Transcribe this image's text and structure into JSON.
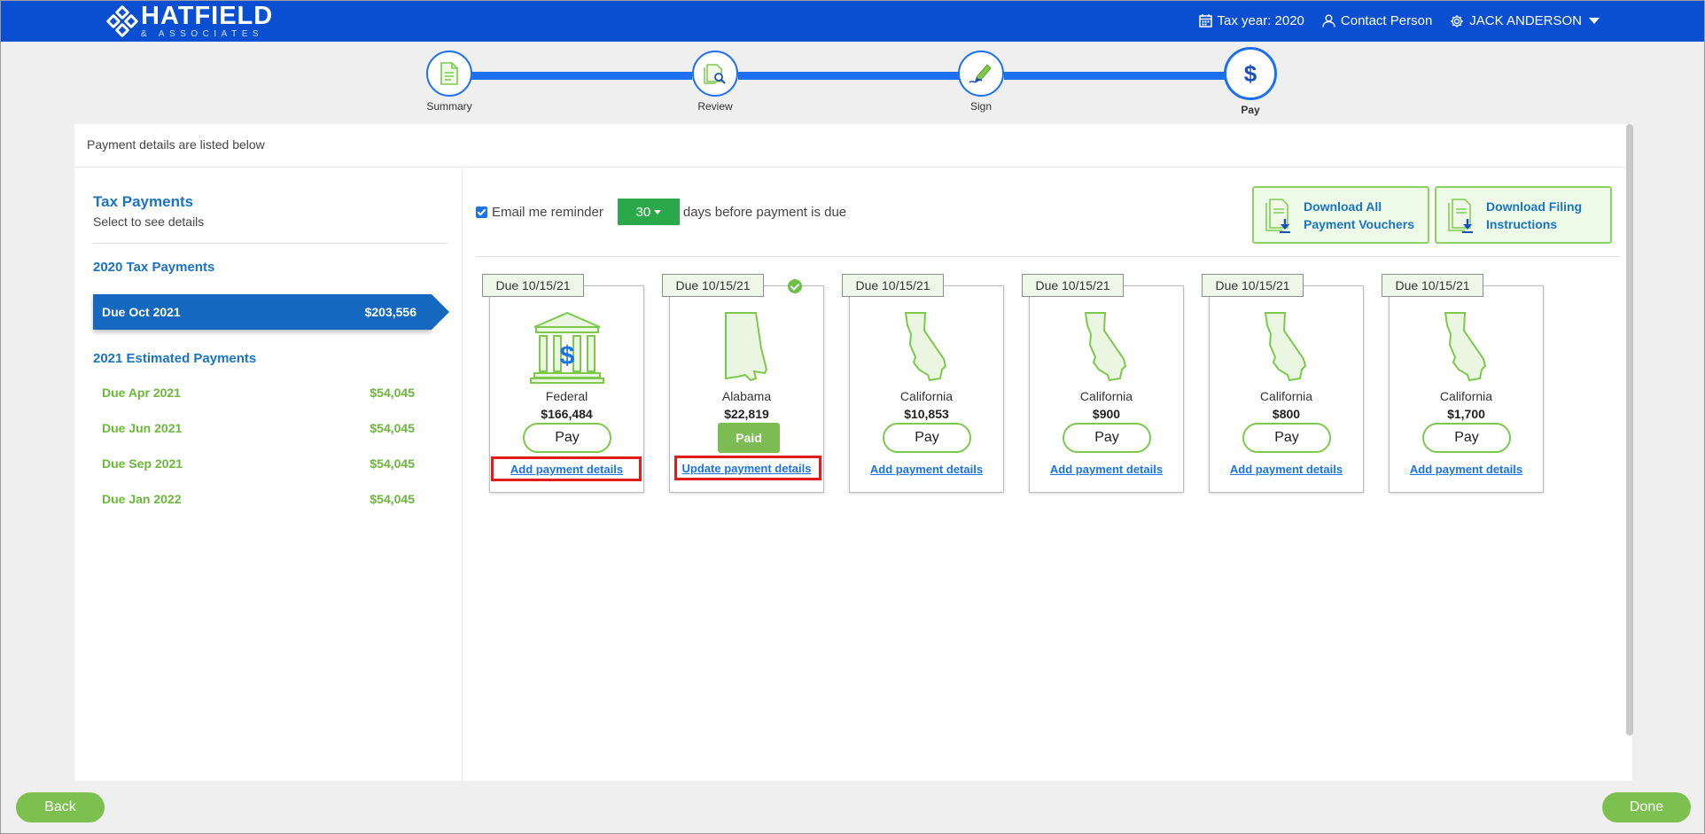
{
  "header": {
    "brand_name": "HATFIELD",
    "brand_sub": "& ASSOCIATES",
    "tax_year": "Tax year: 2020",
    "contact": "Contact Person",
    "user": "JACK ANDERSON",
    "bg_color": "#0a4fd1"
  },
  "stepper": {
    "steps": [
      {
        "label": "Summary",
        "icon": "document-icon"
      },
      {
        "label": "Review",
        "icon": "document-search-icon"
      },
      {
        "label": "Sign",
        "icon": "pen-sign-icon"
      },
      {
        "label": "Pay",
        "icon": "dollar-icon"
      }
    ],
    "active": "Pay"
  },
  "panel": {
    "heading": "Payment details are listed below"
  },
  "sidebar": {
    "title": "Tax Payments",
    "subtitle": "Select to see details",
    "section1": "2020 Tax Payments",
    "active_item": {
      "label": "Due Oct 2021",
      "amount": "$203,556"
    },
    "section2": "2021 Estimated Payments",
    "items": [
      {
        "label": "Due Apr 2021",
        "amount": "$54,045"
      },
      {
        "label": "Due Jun 2021",
        "amount": "$54,045"
      },
      {
        "label": "Due Sep 2021",
        "amount": "$54,045"
      },
      {
        "label": "Due Jan 2022",
        "amount": "$54,045"
      }
    ]
  },
  "reminder": {
    "label": "Email me reminder",
    "days": "30",
    "suffix": "days before payment is due",
    "checked": true
  },
  "downloads": {
    "vouchers_line1": "Download All",
    "vouchers_line2": "Payment Vouchers",
    "instructions_line1": "Download Filing",
    "instructions_line2": "Instructions"
  },
  "cards": [
    {
      "due": "Due 10/15/21",
      "name": "Federal",
      "amount": "$166,484",
      "button": "Pay",
      "link": "Add payment details",
      "icon": "bank-dollar-icon",
      "highlighted": true,
      "paid": false
    },
    {
      "due": "Due 10/15/21",
      "name": "Alabama",
      "amount": "$22,819",
      "button": "Paid",
      "link": "Update payment details",
      "icon": "alabama-map-icon",
      "highlighted": true,
      "paid": true
    },
    {
      "due": "Due 10/15/21",
      "name": "California",
      "amount": "$10,853",
      "button": "Pay",
      "link": "Add payment details",
      "icon": "california-map-icon",
      "highlighted": false,
      "paid": false
    },
    {
      "due": "Due 10/15/21",
      "name": "California",
      "amount": "$900",
      "button": "Pay",
      "link": "Add payment details",
      "icon": "california-map-icon",
      "highlighted": false,
      "paid": false
    },
    {
      "due": "Due 10/15/21",
      "name": "California",
      "amount": "$800",
      "button": "Pay",
      "link": "Add payment details",
      "icon": "california-map-icon",
      "highlighted": false,
      "paid": false
    },
    {
      "due": "Due 10/15/21",
      "name": "California",
      "amount": "$1,700",
      "button": "Pay",
      "link": "Add payment details",
      "icon": "california-map-icon",
      "highlighted": false,
      "paid": false
    }
  ],
  "footer": {
    "back": "Back",
    "done": "Done"
  }
}
